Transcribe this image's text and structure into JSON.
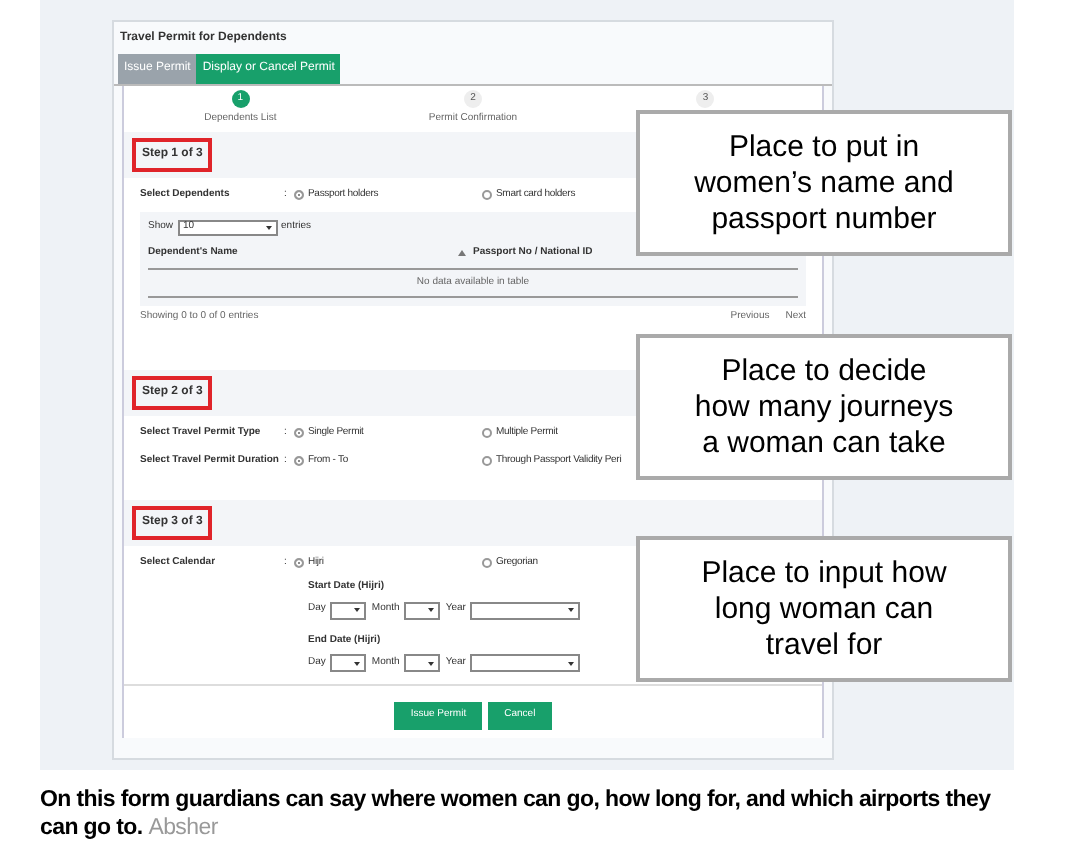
{
  "header": {
    "title": "Travel Permit for Dependents"
  },
  "tabs": [
    {
      "label": "Issue Permit",
      "selected": false
    },
    {
      "label": "Display or Cancel Permit",
      "selected": true
    }
  ],
  "steps": [
    {
      "number": "1",
      "label": "Dependents List",
      "selected": true
    },
    {
      "number": "2",
      "label": "Permit Confirmation",
      "selected": false
    },
    {
      "number": "3",
      "selected": false
    }
  ],
  "step1": {
    "heading": "Step 1 of 3",
    "rows": [
      {
        "label": "Select Dependents",
        "separator": ":",
        "options": [
          {
            "label": "Passport holders",
            "selected": true
          },
          {
            "label": "Smart card holders",
            "selected": false
          }
        ]
      }
    ],
    "table": {
      "show_label": "Show",
      "page_size": "10",
      "entries_label": "entries",
      "columns": [
        {
          "label": "Dependent's Name",
          "sorted": false
        },
        {
          "label": "Passport No / National ID",
          "sorted": true
        }
      ],
      "empty_message": "No data available in table",
      "info": "Showing 0 to 0 of 0 entries",
      "pager": [
        "Previous",
        "Next"
      ]
    }
  },
  "step2": {
    "heading": "Step 2 of 3",
    "rows": [
      {
        "label": "Select Travel Permit Type",
        "separator": ":",
        "options": [
          {
            "label": "Single Permit",
            "selected": true
          },
          {
            "label": "Multiple Permit",
            "selected": false
          }
        ]
      },
      {
        "label": "Select Travel Permit Duration",
        "separator": ":",
        "options": [
          {
            "label": "From - To",
            "selected": true
          },
          {
            "label": "Through Passport Validity Peri",
            "selected": false
          }
        ]
      }
    ]
  },
  "step3": {
    "heading": "Step 3 of 3",
    "rows": [
      {
        "label": "Select Calendar",
        "separator": ":",
        "options": [
          {
            "label": "Hijri",
            "selected": true
          },
          {
            "label": "Gregorian",
            "selected": false
          }
        ]
      }
    ],
    "dates": [
      {
        "label": "Start Date (Hijri)",
        "fields": [
          "Day",
          "Month",
          "Year"
        ]
      },
      {
        "label": "End Date (Hijri)",
        "fields": [
          "Day",
          "Month",
          "Year"
        ]
      }
    ]
  },
  "buttons": [
    "Issue Permit",
    "Cancel"
  ],
  "callouts": [
    "Place to put in women’s name and passport number",
    "Place to decide how many journeys a woman can take",
    "Place to input how long woman can travel for"
  ],
  "caption": {
    "text": "On this form guardians can say where women can go, how long for, and which airports they can go to.",
    "credit": "Absher"
  }
}
